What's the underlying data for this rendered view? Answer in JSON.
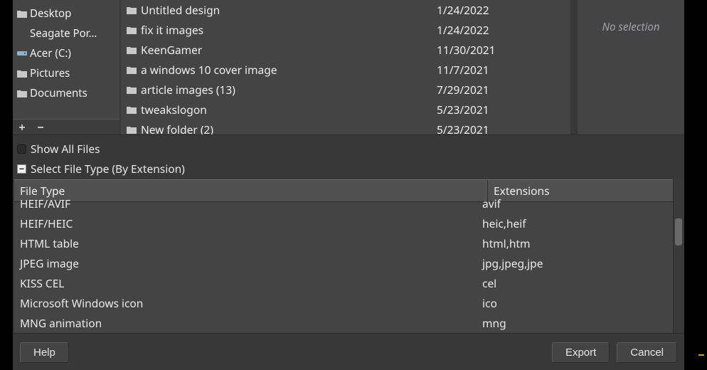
{
  "sidebar": {
    "items": [
      {
        "label": "Desktop",
        "icon": "folder"
      },
      {
        "label": "Seagate Por…",
        "icon": "none"
      },
      {
        "label": "Acer (C:)",
        "icon": "drive"
      },
      {
        "label": "Pictures",
        "icon": "folder"
      },
      {
        "label": "Documents",
        "icon": "folder"
      }
    ]
  },
  "files": [
    {
      "name": "Untitled design",
      "date": "1/24/2022"
    },
    {
      "name": "fix it images",
      "date": "1/24/2022"
    },
    {
      "name": "KeenGamer",
      "date": "11/30/2021"
    },
    {
      "name": "a windows 10 cover image",
      "date": "11/7/2021"
    },
    {
      "name": "article images (13)",
      "date": "7/29/2021"
    },
    {
      "name": "tweakslogon",
      "date": "5/23/2021"
    },
    {
      "name": "New folder (2)",
      "date": "5/23/2021"
    }
  ],
  "preview": {
    "no_selection": "No selection"
  },
  "options": {
    "show_all_files": "Show All Files",
    "select_file_type": "Select File Type (By Extension)"
  },
  "type_table": {
    "headers": {
      "file_type": "File Type",
      "extensions": "Extensions"
    },
    "rows": [
      {
        "file_type": "HEIF/AVIF",
        "extensions": "avif"
      },
      {
        "file_type": "HEIF/HEIC",
        "extensions": "heic,heif"
      },
      {
        "file_type": "HTML table",
        "extensions": "html,htm"
      },
      {
        "file_type": "JPEG image",
        "extensions": "jpg,jpeg,jpe"
      },
      {
        "file_type": "KISS CEL",
        "extensions": "cel"
      },
      {
        "file_type": "Microsoft Windows icon",
        "extensions": "ico"
      },
      {
        "file_type": "MNG animation",
        "extensions": "mng"
      }
    ]
  },
  "buttons": {
    "help": "Help",
    "export": "Export",
    "cancel": "Cancel"
  }
}
